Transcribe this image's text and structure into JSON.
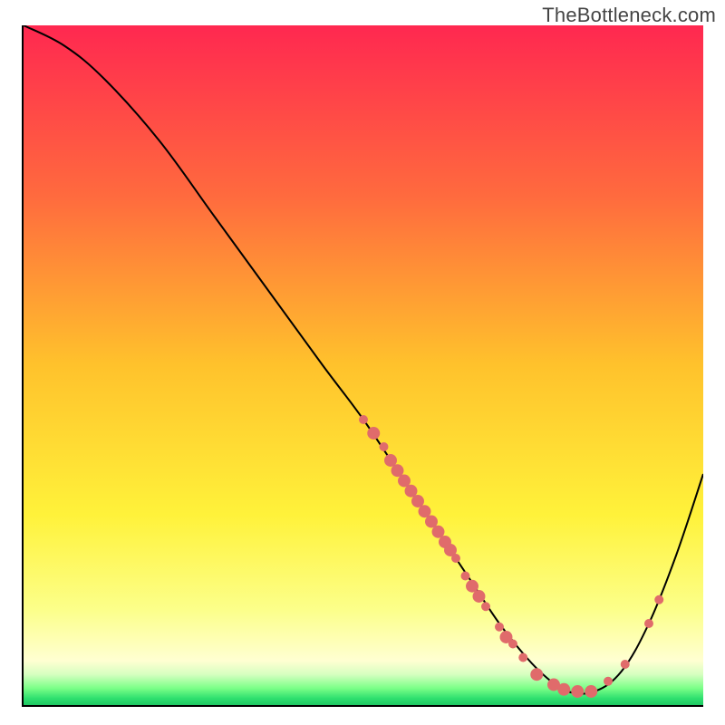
{
  "watermark": "TheBottleneck.com",
  "chart_data": {
    "type": "line",
    "title": "",
    "xlabel": "",
    "ylabel": "",
    "xlim": [
      0,
      100
    ],
    "ylim": [
      0,
      100
    ],
    "grid": false,
    "background_gradient": {
      "direction": "vertical",
      "stops": [
        {
          "offset": 0.0,
          "color": "#ff2850"
        },
        {
          "offset": 0.25,
          "color": "#ff6a3e"
        },
        {
          "offset": 0.5,
          "color": "#ffc22c"
        },
        {
          "offset": 0.72,
          "color": "#fff23a"
        },
        {
          "offset": 0.86,
          "color": "#fcff8a"
        },
        {
          "offset": 0.935,
          "color": "#ffffd2"
        },
        {
          "offset": 0.955,
          "color": "#d6ffc0"
        },
        {
          "offset": 0.975,
          "color": "#7cff88"
        },
        {
          "offset": 0.99,
          "color": "#2fe06f"
        },
        {
          "offset": 1.0,
          "color": "#1fc863"
        }
      ]
    },
    "series": [
      {
        "name": "bottleneck-curve",
        "color": "#000000",
        "stroke_width": 2,
        "x": [
          0,
          6,
          12,
          20,
          28,
          36,
          44,
          50,
          56,
          62,
          66,
          70,
          74,
          77,
          80,
          84,
          88,
          92,
          96,
          100
        ],
        "y": [
          100,
          97,
          92,
          83,
          72,
          61,
          50,
          42,
          33,
          24,
          18,
          12,
          7,
          4,
          2,
          2,
          5,
          12,
          22,
          34
        ]
      }
    ],
    "markers": {
      "name": "highlight-dots",
      "color": "#e06b6b",
      "radius_small": 5,
      "radius_large": 7,
      "points": [
        {
          "x": 50.0,
          "y": 42.0,
          "r": "small"
        },
        {
          "x": 51.5,
          "y": 40.0,
          "r": "large"
        },
        {
          "x": 53.0,
          "y": 38.0,
          "r": "small"
        },
        {
          "x": 54.0,
          "y": 36.0,
          "r": "large"
        },
        {
          "x": 55.0,
          "y": 34.5,
          "r": "large"
        },
        {
          "x": 56.0,
          "y": 33.0,
          "r": "large"
        },
        {
          "x": 57.0,
          "y": 31.5,
          "r": "large"
        },
        {
          "x": 58.0,
          "y": 30.0,
          "r": "large"
        },
        {
          "x": 59.0,
          "y": 28.5,
          "r": "large"
        },
        {
          "x": 60.0,
          "y": 27.0,
          "r": "large"
        },
        {
          "x": 61.0,
          "y": 25.5,
          "r": "large"
        },
        {
          "x": 62.0,
          "y": 24.0,
          "r": "large"
        },
        {
          "x": 62.8,
          "y": 22.8,
          "r": "large"
        },
        {
          "x": 63.6,
          "y": 21.6,
          "r": "small"
        },
        {
          "x": 65.0,
          "y": 19.0,
          "r": "small"
        },
        {
          "x": 66.0,
          "y": 17.5,
          "r": "large"
        },
        {
          "x": 67.0,
          "y": 16.0,
          "r": "large"
        },
        {
          "x": 68.0,
          "y": 14.5,
          "r": "small"
        },
        {
          "x": 70.0,
          "y": 11.5,
          "r": "small"
        },
        {
          "x": 71.0,
          "y": 10.0,
          "r": "large"
        },
        {
          "x": 72.0,
          "y": 9.0,
          "r": "small"
        },
        {
          "x": 73.5,
          "y": 7.0,
          "r": "small"
        },
        {
          "x": 75.5,
          "y": 4.5,
          "r": "large"
        },
        {
          "x": 78.0,
          "y": 3.0,
          "r": "large"
        },
        {
          "x": 79.5,
          "y": 2.3,
          "r": "large"
        },
        {
          "x": 81.5,
          "y": 2.0,
          "r": "large"
        },
        {
          "x": 83.5,
          "y": 2.0,
          "r": "large"
        },
        {
          "x": 86.0,
          "y": 3.5,
          "r": "small"
        },
        {
          "x": 88.5,
          "y": 6.0,
          "r": "small"
        },
        {
          "x": 92.0,
          "y": 12.0,
          "r": "small"
        },
        {
          "x": 93.5,
          "y": 15.5,
          "r": "small"
        }
      ]
    }
  }
}
